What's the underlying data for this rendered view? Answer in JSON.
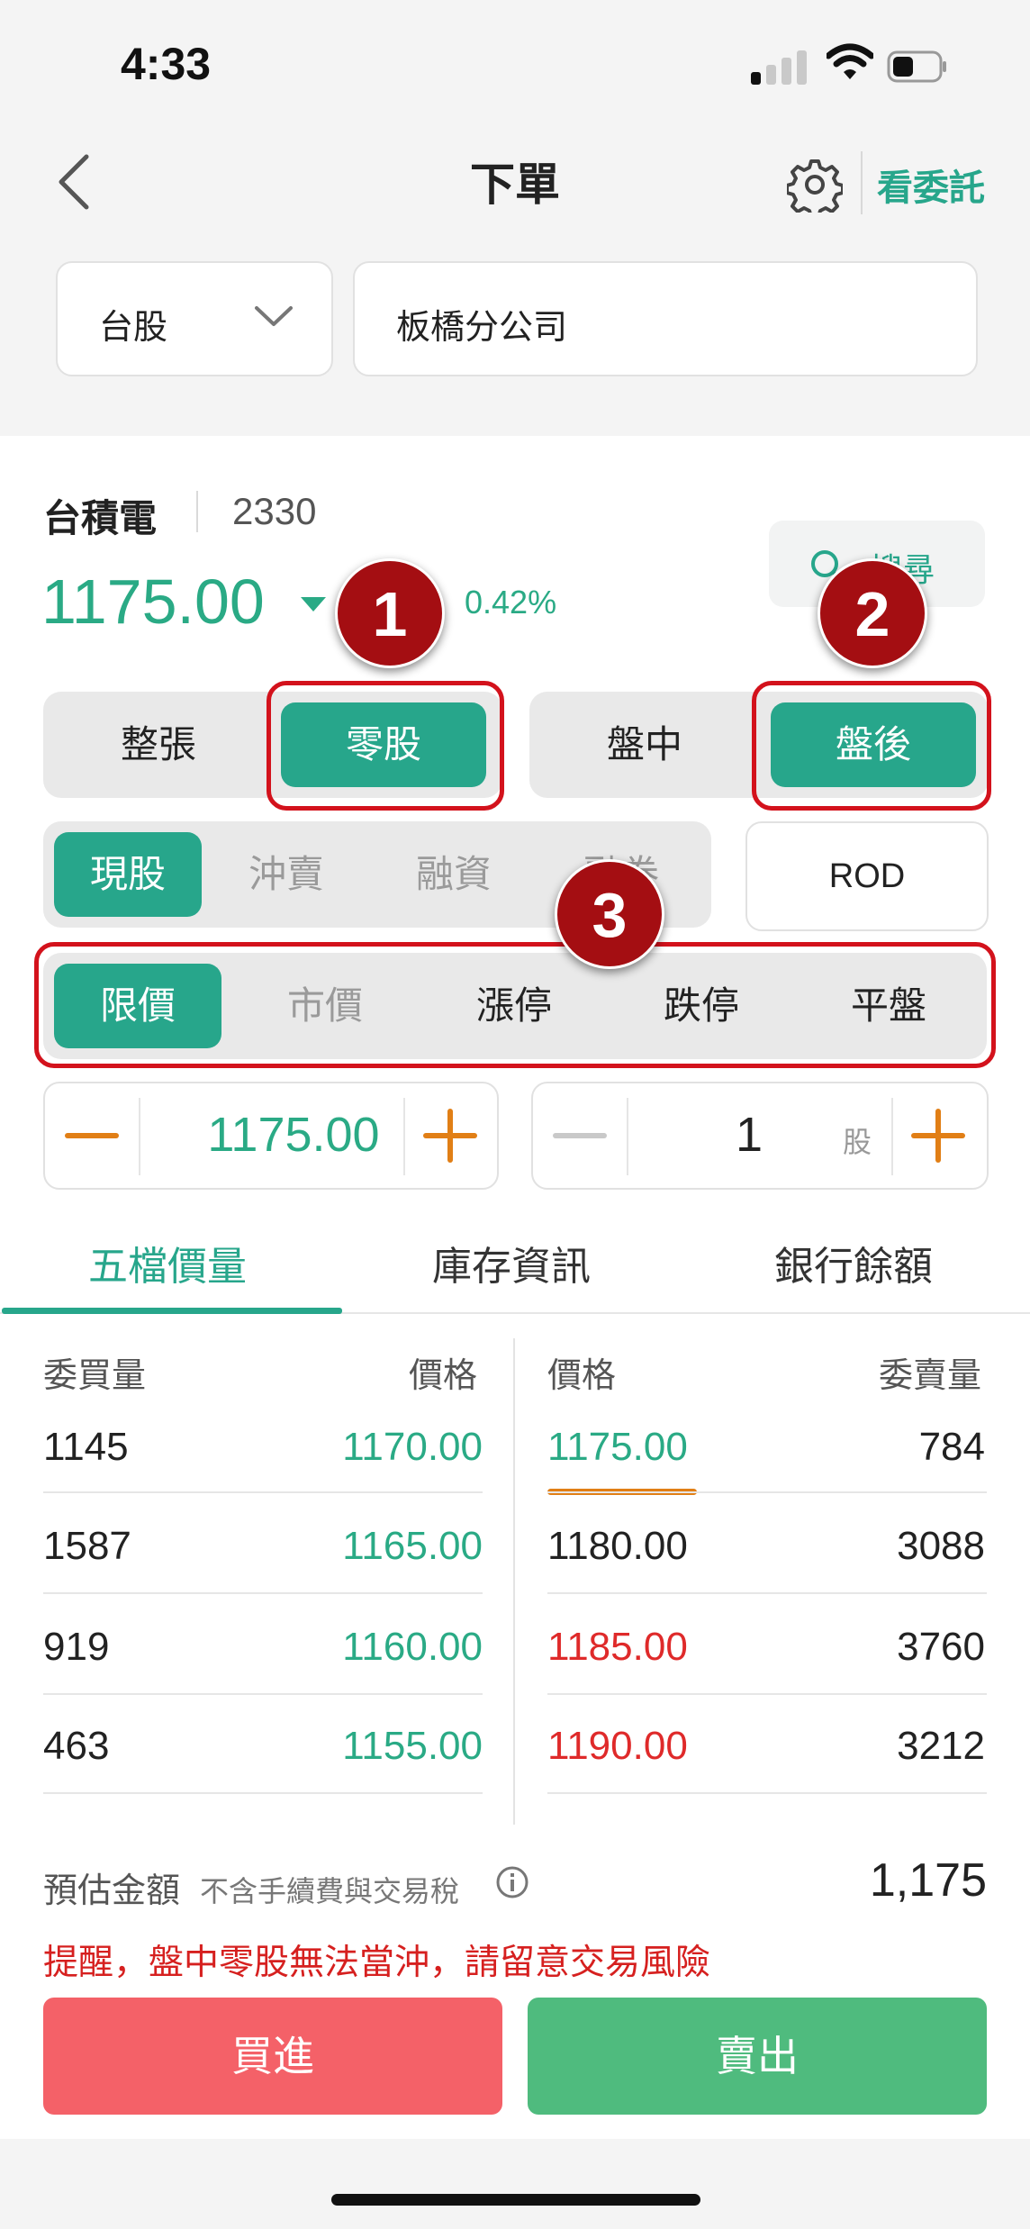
{
  "status_bar": {
    "time": "4:33"
  },
  "header": {
    "title": "下單",
    "view_orders": "看委託"
  },
  "selectors": {
    "market": "台股",
    "branch": "板橋分公司"
  },
  "stock": {
    "name": "台積電",
    "code": "2330",
    "price": "1175.00",
    "change_pct": "0.42%",
    "search_label": "搜尋"
  },
  "annotations": [
    "1",
    "2",
    "3"
  ],
  "lot_type": {
    "options": [
      "整張",
      "零股"
    ],
    "selected": "零股"
  },
  "session": {
    "options": [
      "盤中",
      "盤後"
    ],
    "selected": "盤後"
  },
  "trade_type": {
    "options": [
      "現股",
      "沖賣",
      "融資",
      "融券"
    ],
    "selected": "現股"
  },
  "order_condition": "ROD",
  "price_type": {
    "options": [
      "限價",
      "市價",
      "漲停",
      "跌停",
      "平盤"
    ],
    "selected": "限價"
  },
  "price_input": {
    "value": "1175.00"
  },
  "quantity_input": {
    "value": "1",
    "unit": "股"
  },
  "tabs": [
    "五檔價量",
    "庫存資訊",
    "銀行餘額"
  ],
  "order_book": {
    "headers": {
      "bid_volume": "委買量",
      "bid_price": "價格",
      "ask_price": "價格",
      "ask_volume": "委賣量"
    },
    "bids": [
      {
        "volume": "1145",
        "price": "1170.00"
      },
      {
        "volume": "1587",
        "price": "1165.00"
      },
      {
        "volume": "919",
        "price": "1160.00"
      },
      {
        "volume": "463",
        "price": "1155.00"
      }
    ],
    "asks": [
      {
        "price": "1175.00",
        "volume": "784"
      },
      {
        "price": "1180.00",
        "volume": "3088"
      },
      {
        "price": "1185.00",
        "volume": "3760"
      },
      {
        "price": "1190.00",
        "volume": "3212"
      }
    ]
  },
  "estimate": {
    "label": "預估金額",
    "note": "不含手續費與交易稅",
    "amount": "1,175"
  },
  "warning": "提醒，盤中零股無法當沖，請留意交易風險",
  "actions": {
    "buy": "買進",
    "sell": "賣出"
  },
  "colors": {
    "accent": "#27a68b",
    "up": "#df2a2a",
    "down": "#2aaa85",
    "buy": "#f46168",
    "sell": "#4fbb7e",
    "annotation": "#a40e12"
  }
}
